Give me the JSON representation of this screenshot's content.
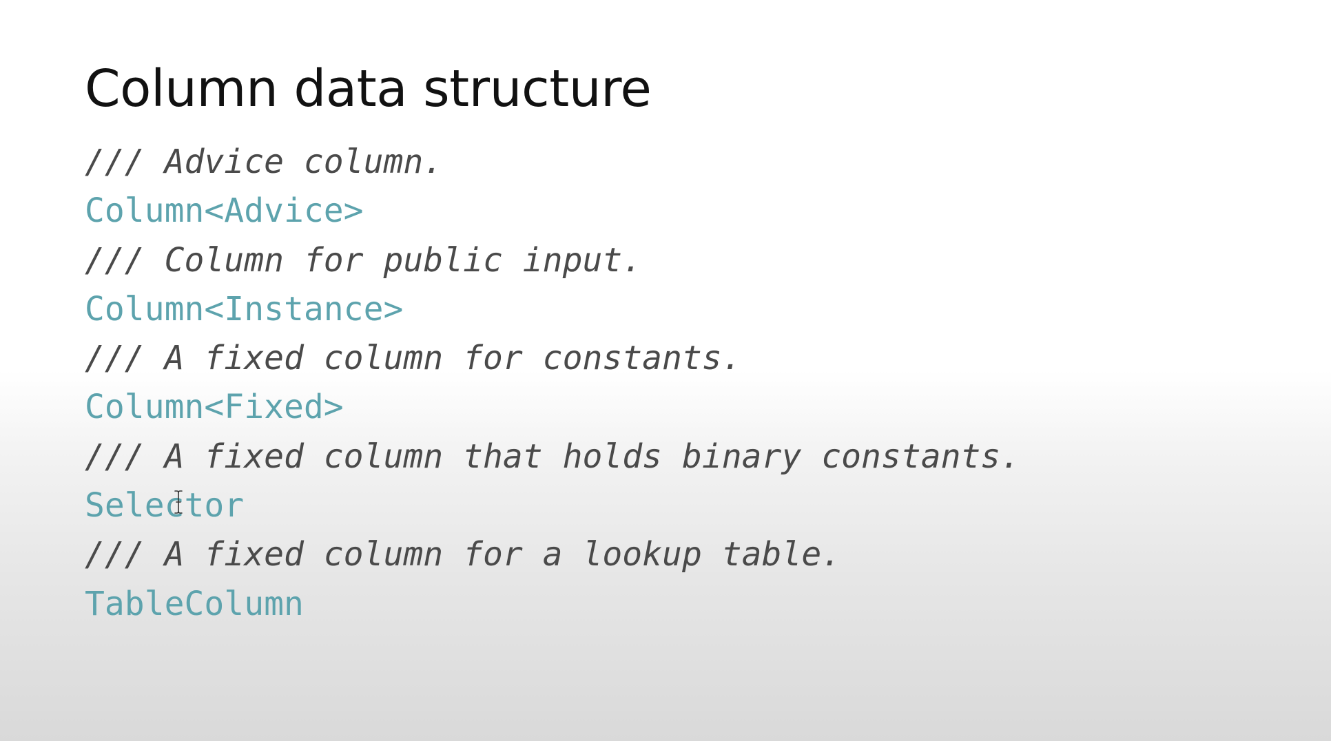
{
  "slide": {
    "title": "Column data structure",
    "code_lines": [
      {
        "kind": "comment",
        "text": "/// Advice column."
      },
      {
        "kind": "type",
        "text": "Column<Advice>"
      },
      {
        "kind": "comment",
        "text": "/// Column for public input."
      },
      {
        "kind": "type",
        "text": "Column<Instance>"
      },
      {
        "kind": "comment",
        "text": "/// A fixed column for constants."
      },
      {
        "kind": "type",
        "text": "Column<Fixed>"
      },
      {
        "kind": "comment",
        "text": "/// A fixed column that holds binary constants."
      },
      {
        "kind": "type",
        "text": "Selector"
      },
      {
        "kind": "comment",
        "text": "/// A fixed column for a lookup table."
      },
      {
        "kind": "type",
        "text": "TableColumn"
      }
    ]
  },
  "colors": {
    "comment": "#4a4a4a",
    "type": "#5da3ad",
    "title": "#111111"
  },
  "icons": {
    "cursor": "text-cursor-icon"
  }
}
